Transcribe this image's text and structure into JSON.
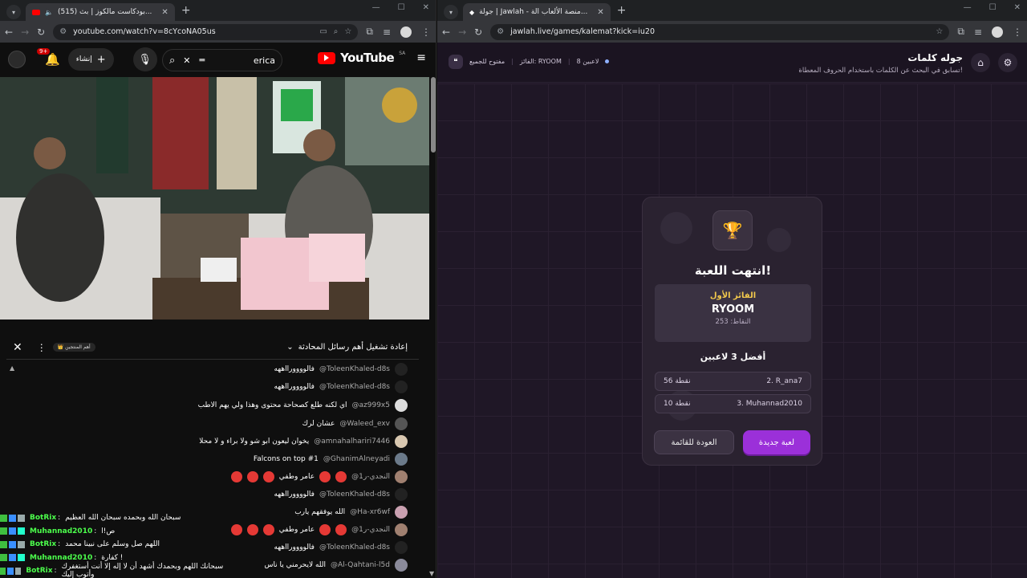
{
  "left_browser": {
    "tab_title": "(515) بودكاست مالكوز | بث...",
    "url": "youtube.com/watch?v=8cYcoNA05us"
  },
  "youtube": {
    "wordmark": "YouTube",
    "region": "SA",
    "search_query": "erica",
    "create_label": "إنشاء",
    "notif_count": "9+"
  },
  "chat": {
    "title": "إعادة تشغيل أهم رسائل المحادثة",
    "members_chip": "أهم المنتجين",
    "messages": [
      {
        "author": "@ToleenKhaled-d8s",
        "text": "فالوووورااههه"
      },
      {
        "author": "@ToleenKhaled-d8s",
        "text": "فالوووورااههه"
      },
      {
        "author": "@az999x5",
        "text": "اي لكنه طلع كصحاحة محتوى وهذا ولي يهم الاطب"
      },
      {
        "author": "@Waleed_exv",
        "text": "عشان لرك"
      },
      {
        "author": "@amnahalhariri7446",
        "text": "يخوان ليعون ابو شو ولا براء و لا محلا"
      },
      {
        "author": "@GhanimAlneyadi",
        "text": "Falcons on top #1"
      },
      {
        "author": "@النجدي-ر1",
        "text": "عامر وطفي"
      },
      {
        "author": "@ToleenKhaled-d8s",
        "text": "فالوووورااههه"
      },
      {
        "author": "@Ha-xr6wf",
        "text": "الله يوفقهم يارب"
      },
      {
        "author": "@النجدي-ر1",
        "text": "عامر وطفي"
      },
      {
        "author": "@ToleenKhaled-d8s",
        "text": "فالوووورااههه"
      },
      {
        "author": "@Al-Qahtani-l5d",
        "text": "الله لايحرمني يا ناس"
      }
    ]
  },
  "botrix": [
    {
      "name": "BotRix",
      "text": "سبحان الله وبحمده سبحان الله العظيم"
    },
    {
      "name": "Muhannad2010",
      "text": "ص!ا"
    },
    {
      "name": "BotRix",
      "text": "اللهم صل وسلم على نبينا محمد"
    },
    {
      "name": "Muhannad2010",
      "text": "كفارة !"
    },
    {
      "name": "BotRix",
      "text": "سبحانك اللهم وبحمدك أشهد أن لا إله إلا أنت أستغفرك وأتوب إليك"
    }
  ],
  "right_browser": {
    "tab_title": "جولة | Jawlah - منصة الألعاب الة...",
    "url": "jawlah.live/games/kalemat?kick=iu20"
  },
  "jawlah": {
    "title": "جوله كلمات",
    "subtitle": "تسابق في البحث عن الكلمات باستخدام الحروف المعطاة!",
    "players": "8 لاعبين",
    "winner_meta": "الفائز: RYOOM",
    "open_to": "مفتوح للجميع",
    "card": {
      "title": "انتهت اللعبة!",
      "winner_label": "الفائز الأول",
      "winner_name": "RYOOM",
      "winner_points": "النقاط: 253",
      "top_title": "أفضل 3 لاعبين",
      "ranks": [
        {
          "player": "2. R_ana7",
          "points": "56 نقطة"
        },
        {
          "player": "3. Muhannad2010",
          "points": "10 نقطة"
        }
      ],
      "new_game": "لعبة جديدة",
      "back": "العودة للقائمة"
    }
  }
}
